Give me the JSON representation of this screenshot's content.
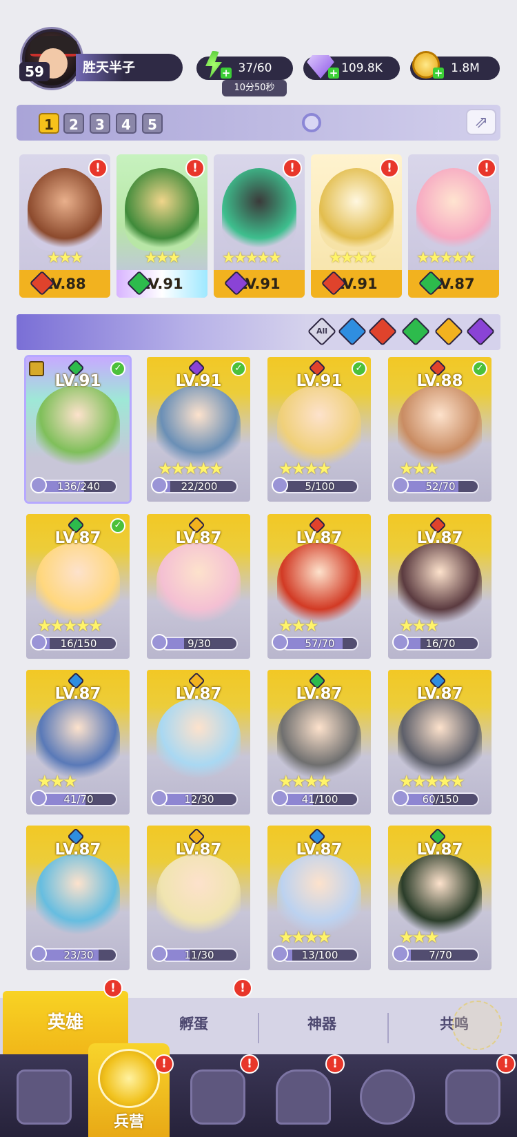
{
  "player": {
    "level": "59",
    "name": "胜天半子"
  },
  "resources": {
    "energy": "37/60",
    "energy_timer": "10分50秒",
    "gems": "109.8K",
    "gold": "1.8M"
  },
  "teams": {
    "tabs": [
      "1",
      "2",
      "3",
      "4",
      "5"
    ],
    "active": "1"
  },
  "team_heroes": [
    {
      "level": "LV.88",
      "stars": "★★★",
      "element": "fire",
      "alert": "!"
    },
    {
      "level": "LV.91",
      "stars": "★★★",
      "element": "grass",
      "alert": "!"
    },
    {
      "level": "LV.91",
      "stars": "★★★★★",
      "element": "dark",
      "alert": "!"
    },
    {
      "level": "LV.91",
      "stars": "★★★★",
      "element": "fire",
      "alert": "!"
    },
    {
      "level": "LV.87",
      "stars": "★★★★★",
      "element": "grass",
      "alert": "!"
    }
  ],
  "filters": {
    "all_label": "All",
    "elements": [
      "water",
      "fire",
      "grass",
      "light",
      "dark"
    ]
  },
  "heroes": [
    {
      "level": "LV.91",
      "element": "grass",
      "stars": "",
      "progress": "136/240",
      "fraction": 0.57,
      "checked": true,
      "framed": true
    },
    {
      "level": "LV.91",
      "element": "dark",
      "stars": "★★★★★",
      "progress": "22/200",
      "fraction": 0.11,
      "checked": true,
      "framed": false
    },
    {
      "level": "LV.91",
      "element": "fire",
      "stars": "★★★★",
      "progress": "5/100",
      "fraction": 0.05,
      "checked": true,
      "framed": false
    },
    {
      "level": "LV.88",
      "element": "fire",
      "stars": "★★★",
      "progress": "52/70",
      "fraction": 0.74,
      "checked": true,
      "framed": false
    },
    {
      "level": "LV.87",
      "element": "grass",
      "stars": "★★★★★",
      "progress": "16/150",
      "fraction": 0.11,
      "checked": true,
      "framed": false
    },
    {
      "level": "LV.87",
      "element": "light",
      "stars": "",
      "progress": "9/30",
      "fraction": 0.3,
      "checked": false,
      "framed": false
    },
    {
      "level": "LV.87",
      "element": "fire",
      "stars": "★★★",
      "progress": "57/70",
      "fraction": 0.81,
      "checked": false,
      "framed": false
    },
    {
      "level": "LV.87",
      "element": "fire",
      "stars": "★★★",
      "progress": "16/70",
      "fraction": 0.23,
      "checked": false,
      "framed": false
    },
    {
      "level": "LV.87",
      "element": "water",
      "stars": "★★★",
      "progress": "41/70",
      "fraction": 0.59,
      "checked": false,
      "framed": false
    },
    {
      "level": "LV.87",
      "element": "light",
      "stars": "",
      "progress": "12/30",
      "fraction": 0.4,
      "checked": false,
      "framed": false
    },
    {
      "level": "LV.87",
      "element": "grass",
      "stars": "★★★★",
      "progress": "41/100",
      "fraction": 0.41,
      "checked": false,
      "framed": false
    },
    {
      "level": "LV.87",
      "element": "water",
      "stars": "★★★★★",
      "progress": "60/150",
      "fraction": 0.4,
      "checked": false,
      "framed": false
    },
    {
      "level": "LV.87",
      "element": "water",
      "stars": "",
      "progress": "23/30",
      "fraction": 0.77,
      "checked": false,
      "framed": false
    },
    {
      "level": "LV.87",
      "element": "light",
      "stars": "",
      "progress": "11/30",
      "fraction": 0.37,
      "checked": false,
      "framed": false
    },
    {
      "level": "LV.87",
      "element": "water",
      "stars": "★★★★",
      "progress": "13/100",
      "fraction": 0.13,
      "checked": false,
      "framed": false
    },
    {
      "level": "LV.87",
      "element": "grass",
      "stars": "★★★",
      "progress": "7/70",
      "fraction": 0.1,
      "checked": false,
      "framed": false
    }
  ],
  "subtabs": {
    "heroes": "英雄",
    "eggs": "孵蛋",
    "artifacts": "神器",
    "resonance": "共鸣"
  },
  "nav": {
    "barracks": "兵营",
    "alert": "!"
  },
  "colors": {
    "fire": "#e0432c",
    "water": "#2f8ee0",
    "grass": "#2dbb4c",
    "light": "#f2b21f",
    "dark": "#8a43d6"
  }
}
